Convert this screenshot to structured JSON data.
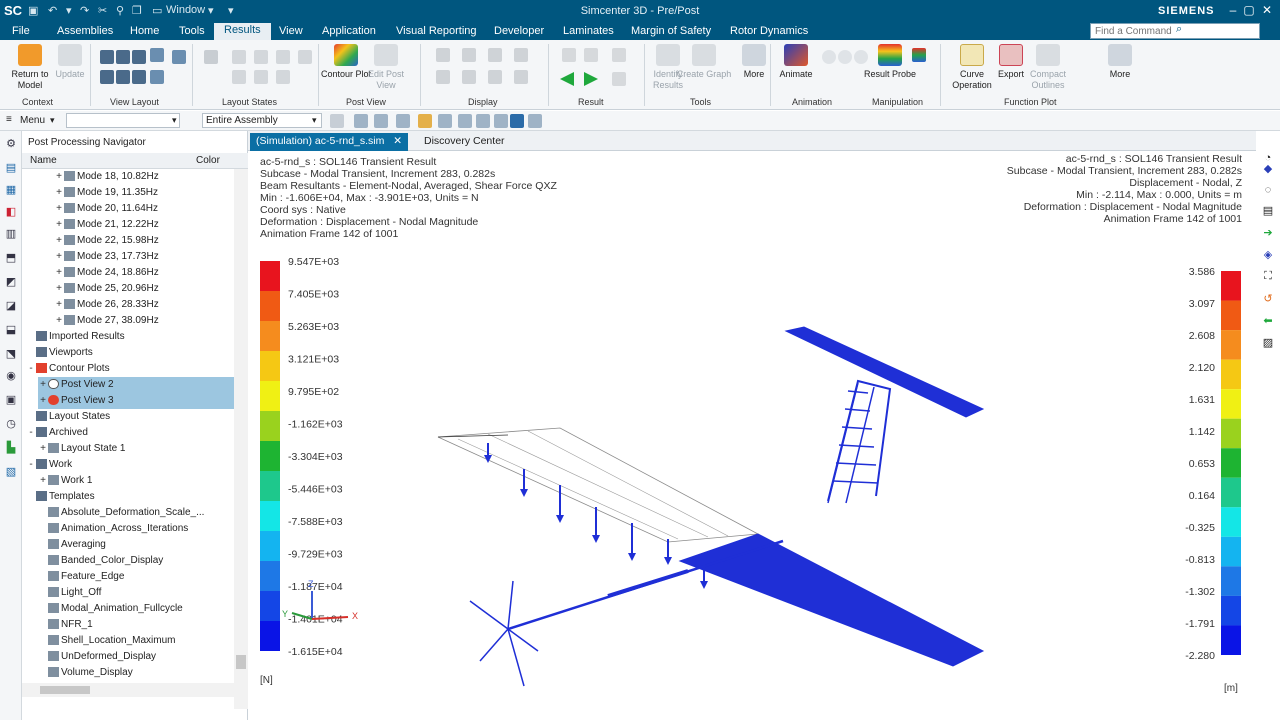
{
  "title_bar": {
    "logo": "SC",
    "window_menu": "Window",
    "app_title": "Simcenter 3D - Pre/Post",
    "brand": "SIEMENS"
  },
  "menubar": {
    "items": [
      "File",
      "Assemblies",
      "Home",
      "Tools",
      "Results",
      "View",
      "Application",
      "Visual Reporting",
      "Developer",
      "Laminates",
      "Margin of Safety",
      "Rotor Dynamics"
    ],
    "active": "Results",
    "search_placeholder": "Find a Command"
  },
  "ribbon": {
    "context": {
      "label": "Context",
      "buttons": [
        {
          "label": "Return to Model",
          "enabled": true
        },
        {
          "label": "Update",
          "enabled": false
        }
      ]
    },
    "view_layout": {
      "label": "View Layout"
    },
    "layout_states": {
      "label": "Layout States"
    },
    "post_view": {
      "label": "Post View",
      "buttons": [
        {
          "label": "Contour Plot",
          "enabled": true
        },
        {
          "label": "Edit Post View",
          "enabled": false
        }
      ]
    },
    "display": {
      "label": "Display"
    },
    "result": {
      "label": "Result"
    },
    "tools": {
      "label": "Tools",
      "buttons": [
        {
          "label": "Identify Results",
          "enabled": false
        },
        {
          "label": "Create Graph",
          "enabled": false
        },
        {
          "label": "More",
          "enabled": true
        }
      ]
    },
    "animation": {
      "label": "Animation",
      "buttons": [
        {
          "label": "Animate",
          "enabled": true
        }
      ]
    },
    "manipulation": {
      "label": "Manipulation",
      "buttons": [
        {
          "label": "Result Probe",
          "enabled": true
        }
      ]
    },
    "function_plot": {
      "label": "Function Plot",
      "buttons": [
        {
          "label": "Curve Operation",
          "enabled": true
        },
        {
          "label": "Export",
          "enabled": true
        },
        {
          "label": "Compact Outlines",
          "enabled": false
        },
        {
          "label": "More",
          "enabled": true
        }
      ]
    }
  },
  "toolbar2": {
    "menu_label": "Menu",
    "filter_value": "",
    "assembly_value": "Entire Assembly"
  },
  "navigator": {
    "title": "Post Processing Navigator",
    "columns": [
      "Name",
      "Color"
    ],
    "rows": [
      {
        "label": "Mode 18, 10.82Hz",
        "level": 2,
        "toggle": "+"
      },
      {
        "label": "Mode 19, 11.35Hz",
        "level": 2,
        "toggle": "+"
      },
      {
        "label": "Mode 20, 11.64Hz",
        "level": 2,
        "toggle": "+"
      },
      {
        "label": "Mode 21, 12.22Hz",
        "level": 2,
        "toggle": "+"
      },
      {
        "label": "Mode 22, 15.98Hz",
        "level": 2,
        "toggle": "+"
      },
      {
        "label": "Mode 23, 17.73Hz",
        "level": 2,
        "toggle": "+"
      },
      {
        "label": "Mode 24, 18.86Hz",
        "level": 2,
        "toggle": "+"
      },
      {
        "label": "Mode 25, 20.96Hz",
        "level": 2,
        "toggle": "+"
      },
      {
        "label": "Mode 26, 28.33Hz",
        "level": 2,
        "toggle": "+"
      },
      {
        "label": "Mode 27, 38.09Hz",
        "level": 2,
        "toggle": "+"
      },
      {
        "label": "Imported Results",
        "level": 0,
        "toggle": ""
      },
      {
        "label": "Viewports",
        "level": 0,
        "toggle": ""
      },
      {
        "label": "Contour Plots",
        "level": 0,
        "toggle": "-"
      },
      {
        "label": "Post View 2",
        "level": 1,
        "toggle": "+",
        "selected": true
      },
      {
        "label": "Post View 3",
        "level": 1,
        "toggle": "+",
        "selected": true
      },
      {
        "label": "Layout States",
        "level": 0,
        "toggle": ""
      },
      {
        "label": "Archived",
        "level": 0,
        "toggle": "-"
      },
      {
        "label": "Layout State 1",
        "level": 1,
        "toggle": "+"
      },
      {
        "label": "Work",
        "level": 0,
        "toggle": "-"
      },
      {
        "label": "Work 1",
        "level": 1,
        "toggle": "+"
      },
      {
        "label": "Templates",
        "level": 0,
        "toggle": ""
      },
      {
        "label": "Absolute_Deformation_Scale_...",
        "level": 1,
        "toggle": ""
      },
      {
        "label": "Animation_Across_Iterations",
        "level": 1,
        "toggle": ""
      },
      {
        "label": "Averaging",
        "level": 1,
        "toggle": ""
      },
      {
        "label": "Banded_Color_Display",
        "level": 1,
        "toggle": ""
      },
      {
        "label": "Feature_Edge",
        "level": 1,
        "toggle": ""
      },
      {
        "label": "Light_Off",
        "level": 1,
        "toggle": ""
      },
      {
        "label": "Modal_Animation_Fullcycle",
        "level": 1,
        "toggle": ""
      },
      {
        "label": "NFR_1",
        "level": 1,
        "toggle": ""
      },
      {
        "label": "Shell_Location_Maximum",
        "level": 1,
        "toggle": ""
      },
      {
        "label": "UnDeformed_Display",
        "level": 1,
        "toggle": ""
      },
      {
        "label": "Volume_Display",
        "level": 1,
        "toggle": ""
      }
    ]
  },
  "tabs": [
    {
      "label": "(Simulation) ac-5-rnd_s.sim",
      "active": true
    },
    {
      "label": "Discovery Center",
      "active": false
    }
  ],
  "viewport": {
    "info_left": [
      "ac-5-rnd_s : SOL146 Transient Result",
      "Subcase - Modal Transient, Increment 283, 0.282s",
      "Beam Resultants - Element-Nodal, Averaged, Shear Force QXZ",
      "Min : -1.606E+04, Max : -3.901E+03, Units = N",
      "Coord sys : Native",
      "Deformation : Displacement - Nodal Magnitude",
      "Animation Frame 142 of 1001"
    ],
    "info_right": [
      "ac-5-rnd_s : SOL146 Transient Result",
      "Subcase - Modal Transient, Increment 283, 0.282s",
      "Displacement - Nodal, Z",
      "Min : -2.114, Max : 0.000, Units = m",
      "Deformation : Displacement - Nodal Magnitude",
      "Animation Frame 142 of 1001"
    ],
    "legend_left": [
      "9.547E+03",
      "7.405E+03",
      "5.263E+03",
      "3.121E+03",
      "9.795E+02",
      "-1.162E+03",
      "-3.304E+03",
      "-5.446E+03",
      "-7.588E+03",
      "-9.729E+03",
      "-1.187E+04",
      "-1.401E+04",
      "-1.615E+04"
    ],
    "legend_right": [
      "3.586",
      "3.097",
      "2.608",
      "2.120",
      "1.631",
      "1.142",
      "0.653",
      "0.164",
      "-0.325",
      "-0.813",
      "-1.302",
      "-1.791",
      "-2.280"
    ],
    "unit_left": "[N]",
    "unit_right": "[m]",
    "legend_colors": [
      "#e8141e",
      "#f05a14",
      "#f58c1e",
      "#f5c814",
      "#f0f014",
      "#9ad21e",
      "#1eb432",
      "#1ec88c",
      "#14e6e6",
      "#14b4f0",
      "#1e78e6",
      "#1446e6",
      "#0a14e6"
    ],
    "structure_color": "#1f2fd6",
    "triad_labels": {
      "x": "X",
      "y": "Y",
      "z": "Z"
    }
  }
}
